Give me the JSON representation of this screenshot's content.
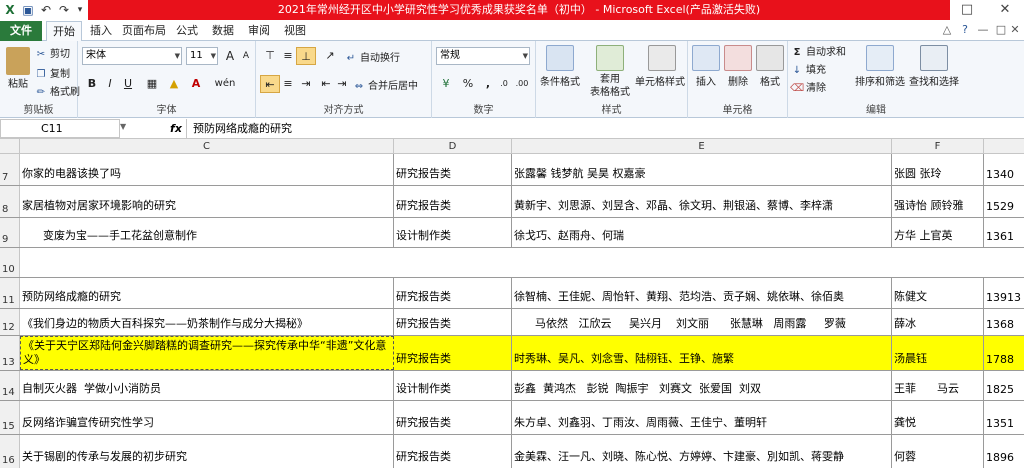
{
  "window": {
    "title": "2021年常州经开区中小学研究性学习优秀成果获奖名单（初中） - Microsoft Excel(产品激活失败)"
  },
  "quick_access": [
    "save-icon",
    "undo-icon",
    "redo-icon",
    "customize-icon"
  ],
  "tabs": [
    "文件",
    "开始",
    "插入",
    "页面布局",
    "公式",
    "数据",
    "审阅",
    "视图"
  ],
  "ribbon": {
    "clipboard": {
      "paste": "粘贴",
      "cut": "剪切",
      "copy": "复制",
      "format_painter": "格式刷",
      "label": "剪贴板"
    },
    "font": {
      "name": "宋体",
      "size": "11",
      "label": "字体",
      "bold": "B",
      "italic": "I",
      "underline": "U",
      "wen": "wén"
    },
    "alignment": {
      "wrap": "自动换行",
      "merge": "合并后居中",
      "label": "对齐方式"
    },
    "number": {
      "format": "常规",
      "label": "数字"
    },
    "styles": {
      "conditional": "条件格式",
      "table": "套用\n表格格式",
      "cell_styles": "单元格样式",
      "label": "样式"
    },
    "cells": {
      "insert": "插入",
      "delete": "删除",
      "format": "格式",
      "label": "单元格"
    },
    "editing": {
      "autosum": "自动求和",
      "fill": "填充",
      "clear": "清除",
      "sort": "排序和筛选",
      "find": "查找和选择",
      "label": "编辑"
    }
  },
  "formula_bar": {
    "cell_ref": "C11",
    "fx": "fx",
    "content": "预防网络成瘾的研究"
  },
  "columns": [
    "C",
    "D",
    "E",
    "F"
  ],
  "rows": [
    {
      "num": "7",
      "c": "你家的电器该换了吗",
      "d": "研究报告类",
      "e": "张露馨  钱梦航  吴昊  权嘉豪",
      "f": "张圆     张玲",
      "g": "1340"
    },
    {
      "num": "8",
      "c": "家居植物对居家环境影响的研究",
      "d": "研究报告类",
      "e": "黄新宇、刘思源、刘昱含、邓晶、徐文玥、荆银涵、蔡博、李梓潇",
      "f": "强诗怡   顾铃雅",
      "g": "1529"
    },
    {
      "num": "9",
      "c": "      变废为宝——手工花盆创意制作",
      "d": "设计制作类",
      "e": "徐戈巧、赵雨舟、何瑞",
      "f": "方华    上官英",
      "g": "1361"
    },
    {
      "num": "10",
      "c": "",
      "d": "",
      "e": "",
      "f": "",
      "g": ""
    },
    {
      "num": "11",
      "c": "预防网络成瘾的研究",
      "d": "研究报告类",
      "e": "徐智楠、王佳妮、周怡轩、黄翔、范均浩、贡子娴、姚依琳、徐佰奥",
      "f": "陈健文",
      "g": "13913"
    },
    {
      "num": "12",
      "c": "《我们身边的物质大百科探究——奶茶制作与成分大揭秘》",
      "d": "研究报告类",
      "e": "      马依然   江欣云     吴兴月    刘文丽      张慧琳   周雨露     罗薇",
      "f": "薛冰",
      "g": "1368"
    },
    {
      "num": "13",
      "c": "《关于天宁区郑陆何金兴脚踏糕的调查研究——探究传承中华“非遗”文化意义》",
      "d": "研究报告类",
      "e": "时秀琳、吴凡、刘念雪、陆栩钰、王铮、施繁",
      "f": "汤晨钰",
      "g": "1788"
    },
    {
      "num": "14",
      "c": "自制灭火器  学做小小消防员",
      "d": "设计制作类",
      "e": "彭鑫  黄鸿杰   彭锐  陶振宇   刘赛文  张爱国  刘双",
      "f": "王菲      马云",
      "g": "1825"
    },
    {
      "num": "15",
      "c": "反网络诈骗宣传研究性学习",
      "d": "研究报告类",
      "e": "朱方卓、刘鑫羽、丁雨汝、周雨薇、王佳宁、董明轩",
      "f": "龚悦",
      "g": "1351"
    },
    {
      "num": "16",
      "c": "关于锡剧的传承与发展的初步研究",
      "d": "研究报告类",
      "e": "金美霖、汪一凡、刘晓、陈心悦、方婷婷、卞建豪、別如凯、蒋雯静",
      "f": "何蓉",
      "g": "1896"
    }
  ],
  "colors": {
    "title_red": "#e8111b",
    "file_green": "#2a7a3b",
    "highlight": "#ffff00"
  }
}
